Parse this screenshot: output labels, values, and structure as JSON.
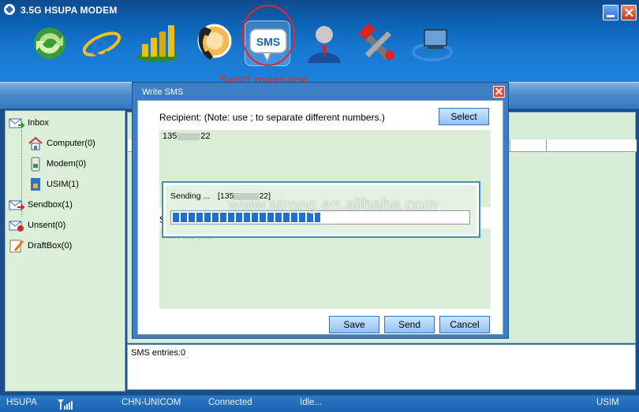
{
  "window": {
    "title": "3.5G HSUPA MODEM"
  },
  "toolbar": {
    "icons": [
      "connect-icon",
      "browser-icon",
      "statistics-icon",
      "phonebook-icon",
      "sms-icon",
      "user-icon",
      "settings-icon",
      "network-icon"
    ],
    "sms_label": "SMS",
    "annotation": "Send message"
  },
  "sidebar": {
    "inbox": "Inbox",
    "computer": "Computer(0)",
    "modem": "Modem(0)",
    "usim": "USIM(1)",
    "sendbox": "Sendbox(1)",
    "unsent": "Unsent(0)",
    "draftbox": "DraftBox(0)"
  },
  "entries": {
    "text": "SMS entries:0"
  },
  "dialog": {
    "title": "Write SMS",
    "recipient_note": "Recipient: (Note: use ; to separate different numbers.)",
    "select_label": "Select",
    "recipient_prefix": "135",
    "recipient_suffix": "22",
    "message_label": "S",
    "message_placeholder": "How are you?",
    "save_label": "Save",
    "send_label": "Send",
    "cancel_label": "Cancel"
  },
  "sending": {
    "label": "Sending ...",
    "number_prefix": "[135",
    "number_suffix": "22]",
    "progress": 0.5
  },
  "watermark": "www.strong.en.alibaba.com",
  "status": {
    "network_type": "HSUPA",
    "operator": "CHN-UNICOM",
    "connection": "Connected",
    "state": "Idle...",
    "sim": "USIM"
  },
  "colors": {
    "title_bar": "#0c62b4",
    "pane_green": "#d9edd7",
    "annotation_red": "#e0282a",
    "progress_blue": "#1e6fd8"
  }
}
